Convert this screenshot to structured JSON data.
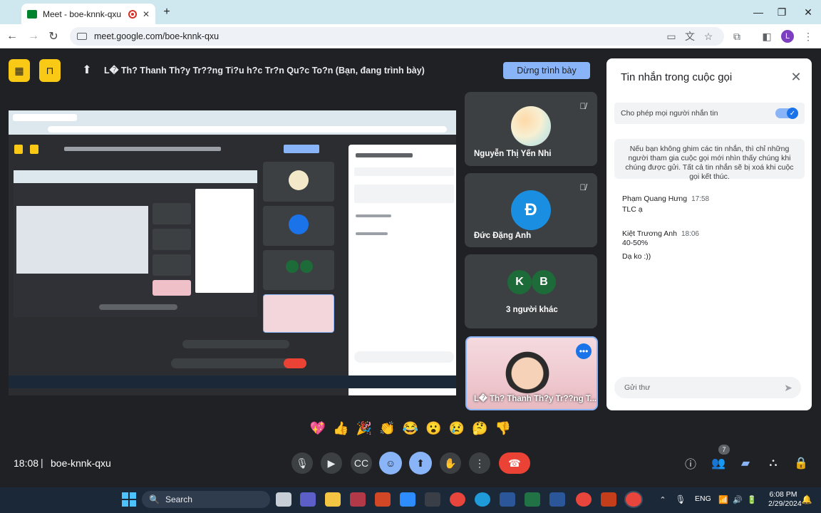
{
  "browser": {
    "tab_title": "Meet - boe-knnk-qxu",
    "url": "meet.google.com/boe-knnk-qxu",
    "profile_initial": "L"
  },
  "presenting": {
    "text": "L� Th? Thanh Th?y Tr??ng Ti?u h?c Tr?n Qu?c To?n (Bạn, đang trình bày)",
    "stop_button": "Dừng trình bày"
  },
  "participants": [
    {
      "name": "Nguyễn Thị Yến Nhi",
      "muted": true
    },
    {
      "name": "Đức Đặng Anh",
      "initial": "Đ",
      "muted": true
    },
    {
      "name": "3 người khác",
      "initials": [
        "K",
        "B"
      ]
    },
    {
      "name": "L� Th? Thanh Th?y Tr??ng T..."
    }
  ],
  "chat": {
    "title": "Tin nhắn trong cuộc gọi",
    "allow_label": "Cho phép mọi người nhắn tin",
    "note": "Nếu bạn không ghim các tin nhắn, thì chỉ những người tham gia cuộc gọi mới nhìn thấy chúng khi chúng được gửi. Tất cả tin nhắn sẽ bị xoá khi cuộc gọi kết thúc.",
    "messages": [
      {
        "sender": "Phạm Quang Hưng",
        "time": "17:58",
        "lines": [
          "TLC ạ"
        ]
      },
      {
        "sender": "Kiệt Trương Anh",
        "time": "18:06",
        "lines": [
          "40-50%",
          "Dạ ko :))"
        ]
      }
    ],
    "input_placeholder": "Gửi thư"
  },
  "reactions": [
    "💖",
    "👍",
    "🎉",
    "👏",
    "😂",
    "😮",
    "😢",
    "🤔",
    "👎"
  ],
  "bottom": {
    "time": "18:08",
    "separator": "|",
    "meeting_code": "boe-knnk-qxu",
    "people_count": "7"
  },
  "taskbar": {
    "search_label": "Search",
    "lang": "ENG",
    "clock_time": "6:08 PM",
    "clock_date": "2/29/2024"
  },
  "colors": {
    "meet_bg": "#202124",
    "accent_blue": "#8ab4f8",
    "hangup_red": "#ea4335",
    "presenter_border": "#8ab4f8"
  }
}
